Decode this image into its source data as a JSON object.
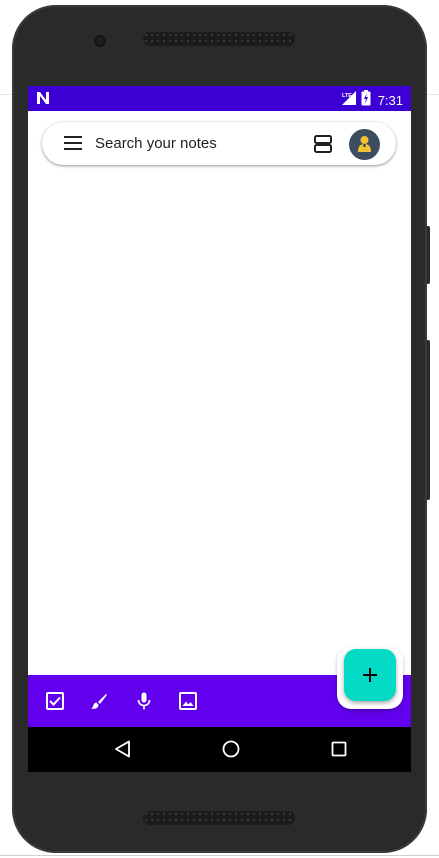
{
  "status_bar": {
    "carrier_icon": "n-logo-icon",
    "network_label": "LTE",
    "time": "7:31",
    "color": "#3d00d4"
  },
  "search_bar": {
    "placeholder": "Search your notes",
    "menu_icon": "menu-icon",
    "view_toggle_icon": "list-view-icon",
    "avatar_icon": "account-avatar"
  },
  "bottom_bar": {
    "color": "#6200ee",
    "actions": [
      "checkbox-icon",
      "brush-icon",
      "microphone-icon",
      "image-icon"
    ]
  },
  "fab": {
    "label": "+",
    "color": "#03dac5"
  },
  "nav_bar": {
    "buttons": [
      "back-icon",
      "home-icon",
      "recents-icon"
    ]
  }
}
